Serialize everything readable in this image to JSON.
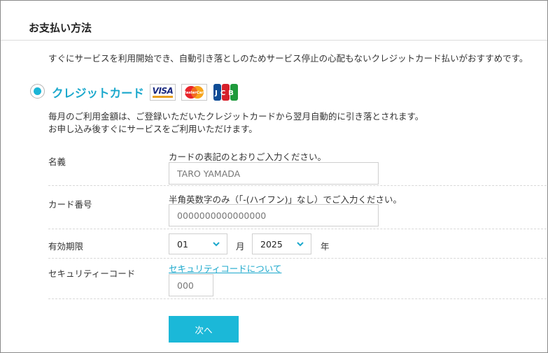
{
  "page": {
    "title": "お支払い方法",
    "intro": "すぐにサービスを利用開始でき、自動引き落としのためサービス停止の心配もないクレジットカード払いがおすすめです。"
  },
  "payment_method": {
    "label": "クレジットカード",
    "selected": true,
    "accent_color": "#1ba8cc",
    "brand_icons": [
      "visa-logo",
      "mastercard-logo",
      "jcb-logo"
    ],
    "brand_texts": {
      "visa": "VISA",
      "mastercard": "MasterCard",
      "jcb": "JCB"
    },
    "description_line1": "毎月のご利用金額は、ご登録いただいたクレジットカードから翌月自動的に引き落とされます。",
    "description_line2": "お申し込み後すぐにサービスをご利用いただけます。"
  },
  "form": {
    "name": {
      "label": "名義",
      "hint": "カードの表記のとおりご入力ください。",
      "placeholder": "TARO YAMADA",
      "value": ""
    },
    "card_number": {
      "label": "カード番号",
      "hint": "半角英数字のみ（「-(ハイフン)」なし）でご入力ください。",
      "placeholder": "0000000000000000",
      "value": ""
    },
    "expiry": {
      "label": "有効期限",
      "month_value": "01",
      "month_unit": "月",
      "year_value": "2025",
      "year_unit": "年"
    },
    "security_code": {
      "label": "セキュリティーコード",
      "link_text": "セキュリティコードについて",
      "placeholder": "000",
      "value": ""
    }
  },
  "actions": {
    "next_label": "次へ",
    "button_color": "#1bb8d8"
  }
}
